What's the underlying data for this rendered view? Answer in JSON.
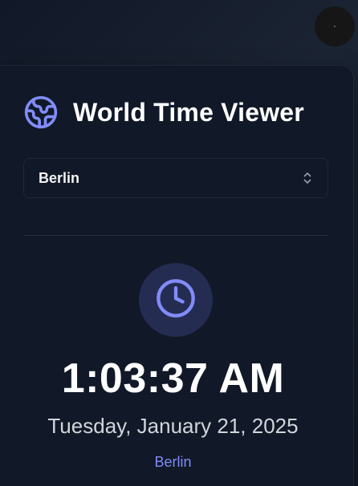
{
  "header": {
    "title": "World Time Viewer",
    "icon": "globe-icon"
  },
  "timezone_select": {
    "selected": "Berlin",
    "icon": "chevrons-up-down-icon"
  },
  "display": {
    "icon": "clock-icon",
    "time": "1:03:37 AM",
    "date": "Tuesday, January 21, 2025",
    "city": "Berlin"
  },
  "colors": {
    "background": "#111827",
    "card": "#111827",
    "accent": "#818cf8",
    "icon_bg": "#242c52",
    "text_primary": "#ffffff",
    "text_secondary": "#d1d5db"
  }
}
